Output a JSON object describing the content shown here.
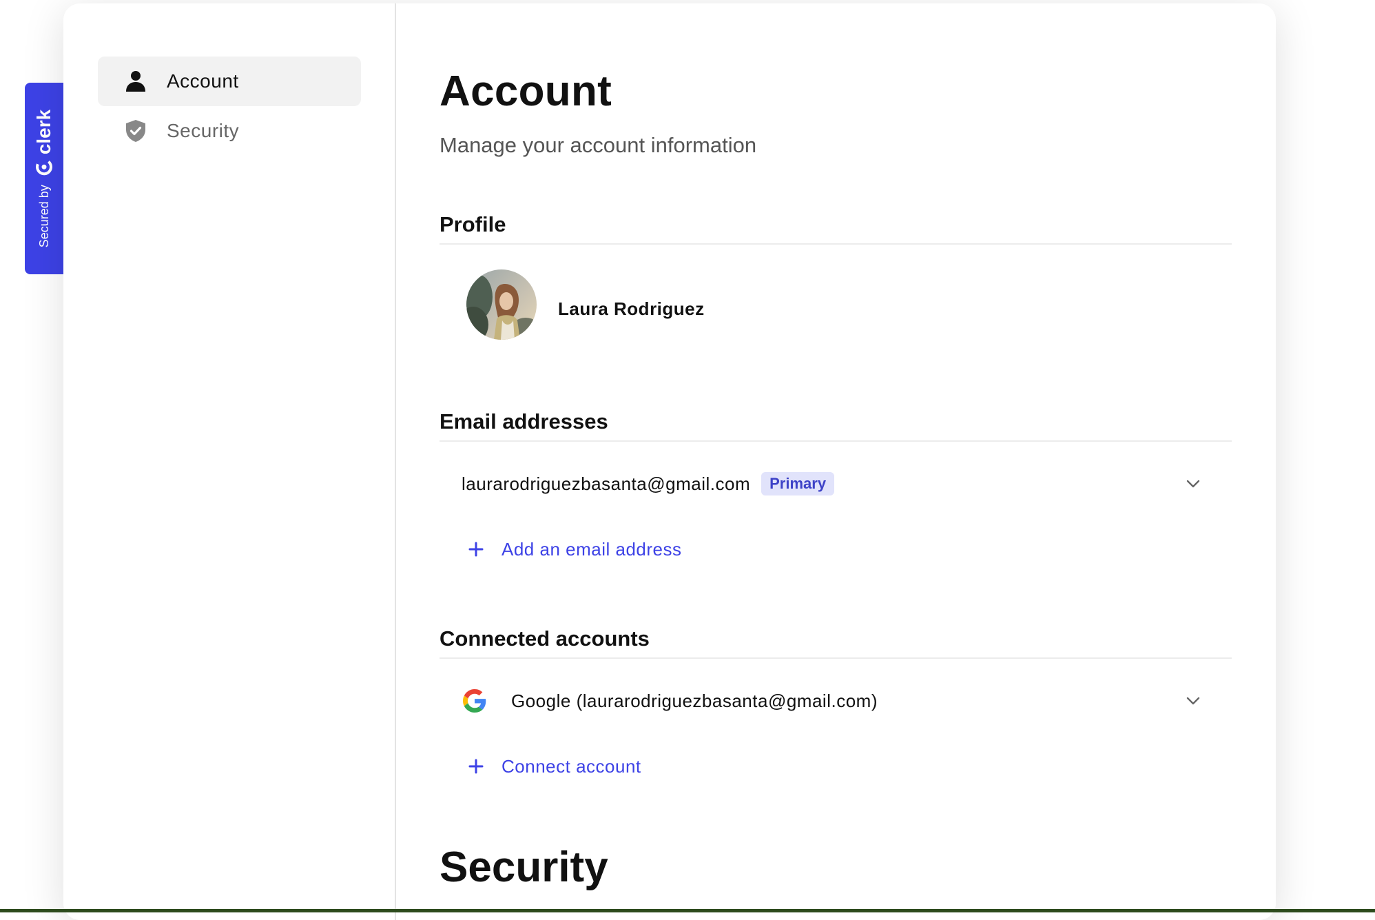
{
  "sidebar": {
    "items": [
      {
        "label": "Account",
        "icon": "person-icon",
        "active": true
      },
      {
        "label": "Security",
        "icon": "shield-check-icon",
        "active": false
      }
    ]
  },
  "clerk_badge": {
    "secured_by": "Secured by",
    "brand": "clerk"
  },
  "main": {
    "title": "Account",
    "subtitle": "Manage your account information",
    "profile": {
      "heading": "Profile",
      "name": "Laura Rodriguez"
    },
    "emails": {
      "heading": "Email addresses",
      "items": [
        {
          "address": "laurarodriguezbasanta@gmail.com",
          "badge": "Primary"
        }
      ],
      "add_label": "Add an email address"
    },
    "connected": {
      "heading": "Connected accounts",
      "items": [
        {
          "provider_icon": "google-icon",
          "label": "Google (laurarodriguezbasanta@gmail.com)"
        }
      ],
      "add_label": "Connect account"
    },
    "security_title": "Security"
  },
  "colors": {
    "accent": "#3d42e6",
    "badge_bg": "#e1e3fb",
    "badge_text": "#3d42c7",
    "nav_active_bg": "#f2f2f2"
  }
}
